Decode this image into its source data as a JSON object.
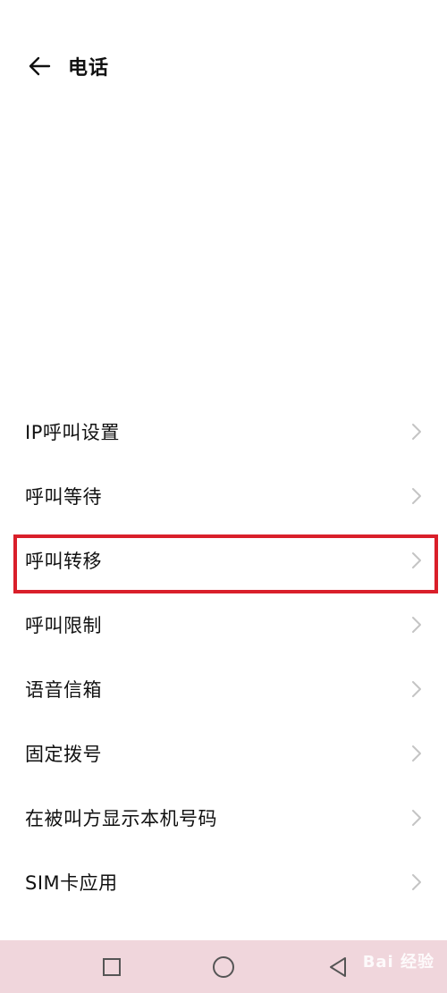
{
  "header": {
    "title": "电话",
    "back_icon": "arrow-left-icon"
  },
  "settings": {
    "items": [
      {
        "label": "IP呼叫设置"
      },
      {
        "label": "呼叫等待"
      },
      {
        "label": "呼叫转移"
      },
      {
        "label": "呼叫限制"
      },
      {
        "label": "语音信箱"
      },
      {
        "label": "固定拨号"
      },
      {
        "label": "在被叫方显示本机号码"
      },
      {
        "label": "SIM卡应用"
      }
    ],
    "highlighted_item": "呼叫转移",
    "highlight_color": "#d91f2a"
  },
  "navbar": {
    "recents_icon": "square-icon",
    "home_icon": "circle-icon",
    "back_icon": "triangle-back-icon",
    "background": "#f0d6dc"
  },
  "watermark": {
    "text": "Bai 经验"
  }
}
